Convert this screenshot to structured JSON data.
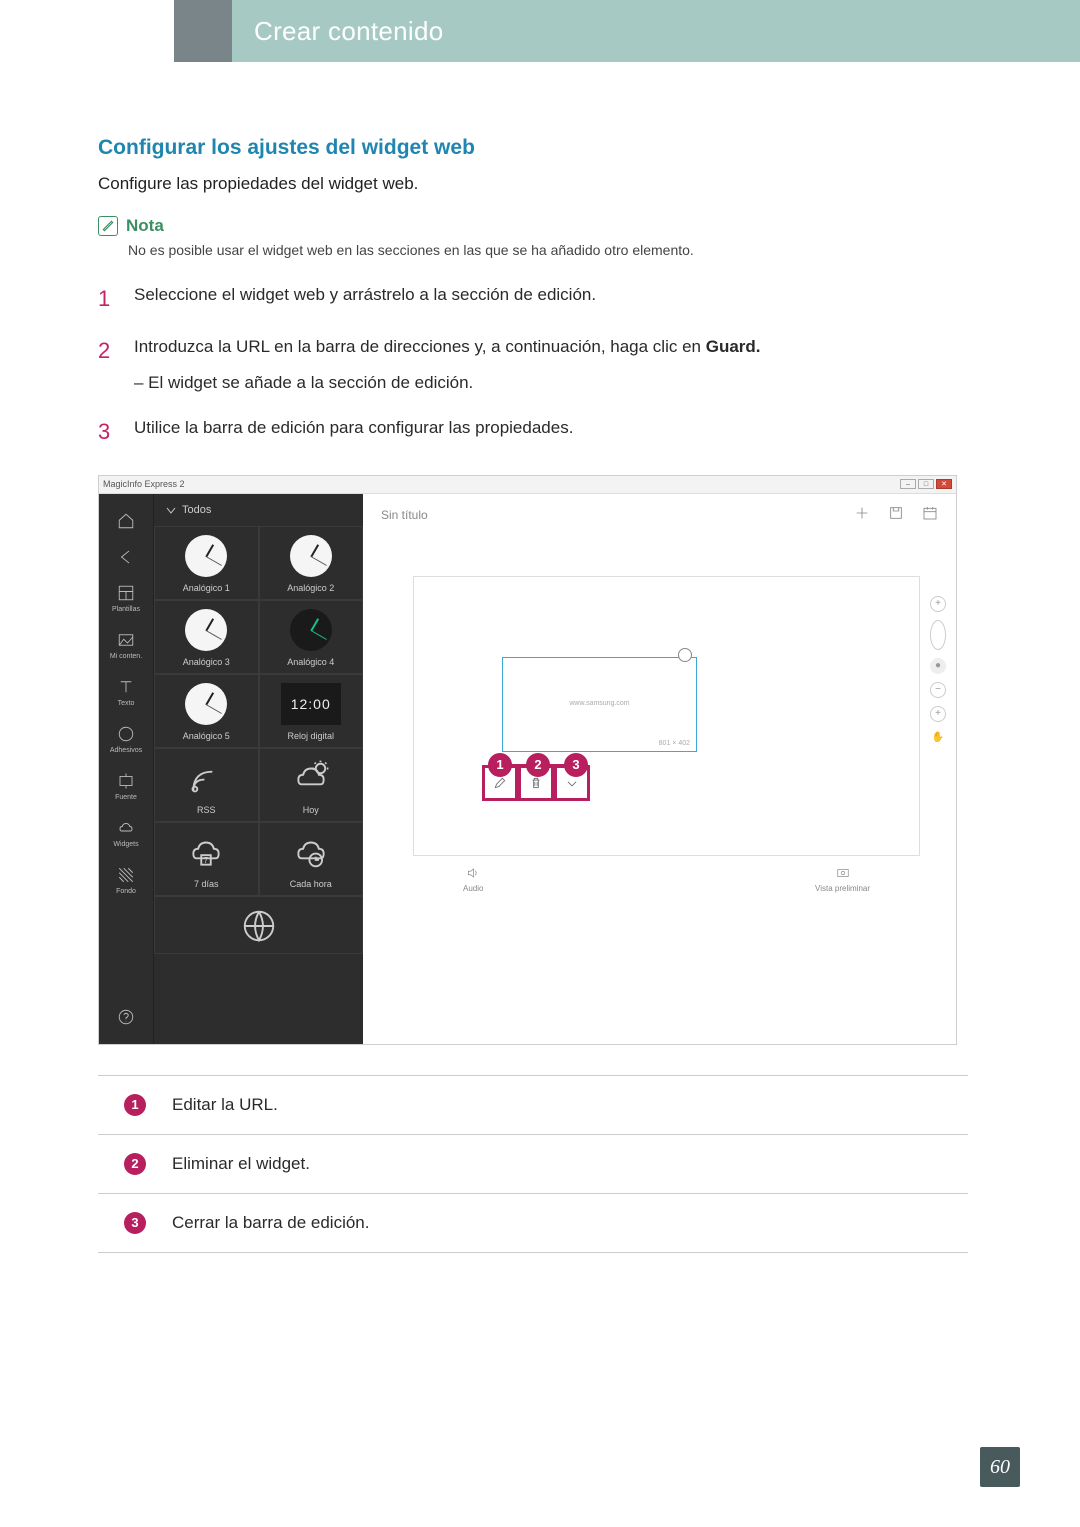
{
  "header": {
    "title": "Crear contenido"
  },
  "section": {
    "heading": "Configurar los ajustes del widget web",
    "intro": "Configure las propiedades del widget web."
  },
  "note": {
    "label": "Nota",
    "text": "No es posible usar el widget web en las secciones en las que se ha añadido otro elemento."
  },
  "steps": {
    "s1_num": "1",
    "s1": "Seleccione el widget web y arrástrelo a la sección de edición.",
    "s2_num": "2",
    "s2a": "Introduzca la URL en la barra de direcciones y, a continuación, haga clic en ",
    "s2b": "Guard.",
    "s2_sub": "– El widget se añade a la sección de edición.",
    "s3_num": "3",
    "s3": "Utilice la barra de edición para configurar las propiedades."
  },
  "app": {
    "title": "MagicInfo Express 2",
    "doc_title": "Sin título",
    "panel_filter": "Todos",
    "sidebar": {
      "plantillas": "Plantillas",
      "miconten": "Mi conten.",
      "texto": "Texto",
      "adhesivos": "Adhesivos",
      "fuente": "Fuente",
      "widgets": "Widgets",
      "fondo": "Fondo"
    },
    "widgets": {
      "a1": "Analógico 1",
      "a2": "Analógico 2",
      "a3": "Analógico 3",
      "a4": "Analógico 4",
      "a5": "Analógico 5",
      "dig": "Reloj digital",
      "dig_time": "12:00",
      "rss": "RSS",
      "hoy": "Hoy",
      "d7": "7 días",
      "hora": "Cada hora"
    },
    "canvas": {
      "url_text": "www.samsung.com",
      "dim": "801 × 402"
    },
    "footer": {
      "audio": "Audio",
      "preview": "Vista preliminar"
    }
  },
  "legend": {
    "l1_num": "1",
    "l1": "Editar la URL.",
    "l2_num": "2",
    "l2": "Eliminar el widget.",
    "l3_num": "3",
    "l3": "Cerrar la barra de edición."
  },
  "callouts": {
    "c1": "1",
    "c2": "2",
    "c3": "3"
  },
  "page_number": "60"
}
